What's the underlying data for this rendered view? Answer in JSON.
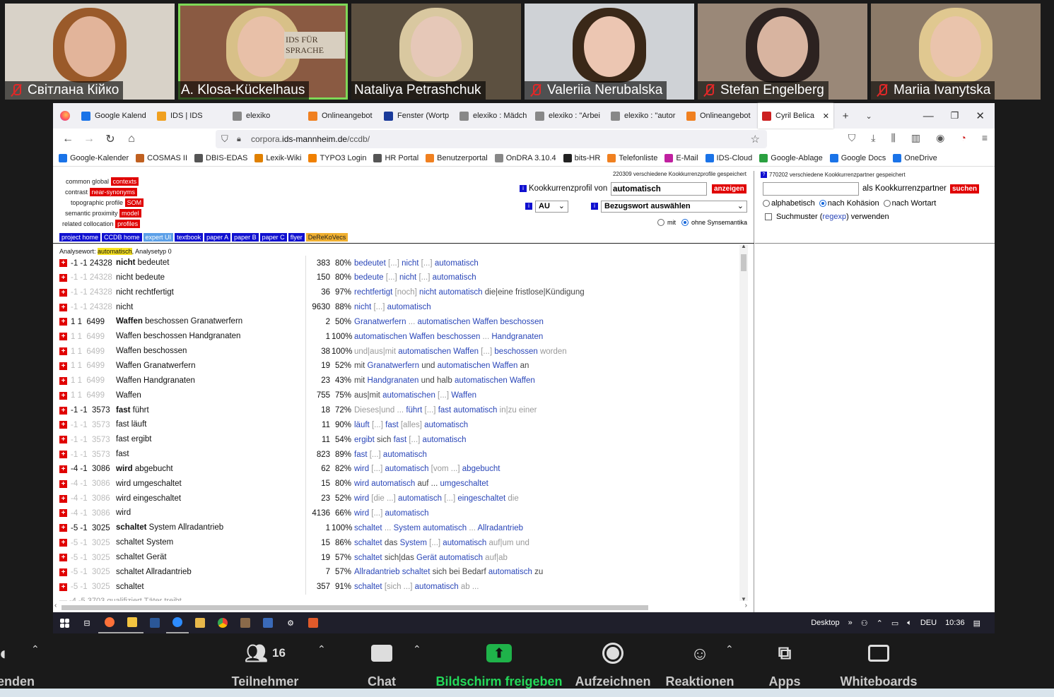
{
  "participants": [
    {
      "name": "Світлана Кійко",
      "muted": true,
      "bg": "#d8d2c8",
      "face": "#e2b49a",
      "hair": "#9a5a2a"
    },
    {
      "name": "A. Klosa-Kückelhaus",
      "muted": false,
      "active": true,
      "bg": "#8a5a42",
      "face": "#e8c0a8",
      "hair": "#d8c088",
      "banner": "IDS FÜR SPRACHE"
    },
    {
      "name": "Nataliya Petrashchuk",
      "muted": false,
      "bg": "#5c5040",
      "face": "#e6c8b8",
      "hair": "#d9c8a0"
    },
    {
      "name": "Valeriia Nerubalska",
      "muted": true,
      "bg": "#cfd2d6",
      "face": "#ecc6b2",
      "hair": "#3a2818"
    },
    {
      "name": "Stefan Engelberg",
      "muted": true,
      "bg": "#9a8878",
      "face": "#d8b4a0",
      "hair": "#2c2220"
    },
    {
      "name": "Mariia Ivanytska",
      "muted": true,
      "bg": "#8c7a68",
      "face": "#eac4ac",
      "hair": "#e0c890"
    }
  ],
  "browser": {
    "tabs": [
      {
        "label": "Google Kalend",
        "icon": "calendar-icon",
        "color": "#1a73e8"
      },
      {
        "label": "IDS | IDS",
        "icon": "ids-icon",
        "color": "#f0a020"
      },
      {
        "label": "elexiko",
        "icon": "elexiko-icon",
        "color": "#888"
      },
      {
        "label": "Onlineangebot",
        "icon": "ids-icon",
        "color": "#f08020"
      },
      {
        "label": "Fenster (Wortp",
        "icon": "doc-icon",
        "color": "#1a3a9a"
      },
      {
        "label": "elexiko : Mädch",
        "icon": "elexiko-icon",
        "color": "#888"
      },
      {
        "label": "elexiko : \"Arbei",
        "icon": "elexiko-icon",
        "color": "#888"
      },
      {
        "label": "elexiko : \"autor",
        "icon": "elexiko-icon",
        "color": "#888"
      },
      {
        "label": "Onlineangebot",
        "icon": "ids-icon",
        "color": "#f08020"
      },
      {
        "label": "Cyril Belica",
        "icon": "flag-icon",
        "color": "#cc2020",
        "active": true
      }
    ],
    "url_prefix": "corpora.",
    "url_domain": "ids-mannheim.de",
    "url_path": "/ccdb/",
    "bookmarks": [
      {
        "label": "Google-Kalender",
        "color": "#1a73e8"
      },
      {
        "label": "COSMAS II",
        "color": "#c06020"
      },
      {
        "label": "DBIS-EDAS",
        "color": "#555"
      },
      {
        "label": "Lexik-Wiki",
        "color": "#e08000"
      },
      {
        "label": "TYPO3 Login",
        "color": "#f08000"
      },
      {
        "label": "HR Portal",
        "color": "#555"
      },
      {
        "label": "Benutzerportal",
        "color": "#f08020"
      },
      {
        "label": "OnDRA 3.10.4",
        "color": "#888"
      },
      {
        "label": "bits-HR",
        "color": "#222"
      },
      {
        "label": "Telefonliste",
        "color": "#f08020"
      },
      {
        "label": "E-Mail",
        "color": "#c020a0"
      },
      {
        "label": "IDS-Cloud",
        "color": "#1a73e8"
      },
      {
        "label": "Google-Ablage",
        "color": "#2aa040"
      },
      {
        "label": "Google Docs",
        "color": "#1a73e8"
      },
      {
        "label": "OneDrive",
        "color": "#1a73e8"
      }
    ]
  },
  "ccdb": {
    "commands": [
      {
        "label": "common global",
        "tag": "contexts"
      },
      {
        "label": "contrast",
        "tag": "near-synonyms"
      },
      {
        "label": "topographic profile",
        "tag": "SOM"
      },
      {
        "label": "semantic proximity",
        "tag": "model"
      },
      {
        "label": "related collocation",
        "tag": "profiles"
      }
    ],
    "links": [
      {
        "label": "project home",
        "style": "blue"
      },
      {
        "label": "CCDB home",
        "style": "blue"
      },
      {
        "label": "expert UI",
        "style": "lblue"
      },
      {
        "label": "textbook",
        "style": "blue"
      },
      {
        "label": "paper A",
        "style": "blue"
      },
      {
        "label": "paper B",
        "style": "blue"
      },
      {
        "label": "paper C",
        "style": "blue"
      },
      {
        "label": "flyer",
        "style": "blue"
      },
      {
        "label": "DeReKoVecs",
        "style": "orange"
      }
    ],
    "profiles_count": "220309 verschiedene Kookkurrenzprofile gespeichert",
    "profile_label": "Kookkurrenzprofil von",
    "profile_value": "automatisch",
    "show_button": "anzeigen",
    "corpus": "AU",
    "reference_select": "Bezugswort auswählen",
    "radio_with": "mit",
    "radio_without": "ohne Synsemantika",
    "analysis_label": "Analysewort:",
    "analysis_word": "automatisch",
    "analysis_type": ", Analysetyp 0",
    "partners_count": "770202 verschiedene Kookkurrenzpartner gespeichert",
    "partner_label": "als Kookkurrenzpartner",
    "search_button": "suchen",
    "sort_alpha": "alphabetisch",
    "sort_cohesion": "nach Kohäsion",
    "sort_wordtype": "nach Wortart",
    "regex_pre": "Suchmuster (",
    "regex_link": "regexp",
    "regex_post": ") verwenden"
  },
  "rows": [
    {
      "idx": "-1 -1 24328",
      "g": false,
      "bold": "nicht",
      "rest": " bedeutet",
      "freq": "383",
      "pct": "80%",
      "ctx": [
        [
          "a",
          "bedeutet"
        ],
        [
          "m",
          " [...] "
        ],
        [
          "a",
          "nicht"
        ],
        [
          "m",
          " [...] "
        ],
        [
          "a",
          "automatisch"
        ]
      ]
    },
    {
      "idx": "-1 -1 24328",
      "g": true,
      "bold": "",
      "rest": "nicht bedeute",
      "freq": "150",
      "pct": "80%",
      "ctx": [
        [
          "a",
          "bedeute"
        ],
        [
          "m",
          " [...] "
        ],
        [
          "a",
          "nicht"
        ],
        [
          "m",
          " [...] "
        ],
        [
          "a",
          "automatisch"
        ]
      ]
    },
    {
      "idx": "-1 -1 24328",
      "g": true,
      "bold": "",
      "rest": "nicht rechtfertigt",
      "freq": "36",
      "pct": "97%",
      "ctx": [
        [
          "a",
          "rechtfertigt"
        ],
        [
          "m",
          " [noch] "
        ],
        [
          "a",
          "nicht automatisch"
        ],
        [
          "t",
          " die|eine fristlose|Kündigung"
        ]
      ]
    },
    {
      "idx": "-1 -1 24328",
      "g": true,
      "bold": "",
      "rest": "nicht",
      "freq": "9630",
      "pct": "88%",
      "ctx": [
        [
          "a",
          "nicht"
        ],
        [
          "m",
          " [...] "
        ],
        [
          "a",
          "automatisch"
        ]
      ]
    },
    {
      "idx": "1 1  6499",
      "g": false,
      "bold": "Waffen",
      "rest": " beschossen Granatwerfern",
      "freq": "2",
      "pct": "50%",
      "ctx": [
        [
          "a",
          "Granatwerfern"
        ],
        [
          "m",
          " ... "
        ],
        [
          "a",
          "automatischen Waffen beschossen"
        ]
      ]
    },
    {
      "idx": "1 1  6499",
      "g": true,
      "bold": "",
      "rest": "Waffen beschossen Handgranaten",
      "freq": "1",
      "pct": "100%",
      "ctx": [
        [
          "a",
          "automatischen Waffen beschossen"
        ],
        [
          "m",
          " ... "
        ],
        [
          "a",
          "Handgranaten"
        ]
      ]
    },
    {
      "idx": "1 1  6499",
      "g": true,
      "bold": "",
      "rest": "Waffen beschossen",
      "freq": "38",
      "pct": "100%",
      "ctx": [
        [
          "m",
          "und|aus|mit "
        ],
        [
          "a",
          "automatischen Waffen"
        ],
        [
          "m",
          " [...] "
        ],
        [
          "a",
          "beschossen"
        ],
        [
          "m",
          " worden"
        ]
      ]
    },
    {
      "idx": "1 1  6499",
      "g": true,
      "bold": "",
      "rest": "Waffen Granatwerfern",
      "freq": "19",
      "pct": "52%",
      "ctx": [
        [
          "t",
          "mit "
        ],
        [
          "a",
          "Granatwerfern"
        ],
        [
          "t",
          " und "
        ],
        [
          "a",
          "automatischen Waffen"
        ],
        [
          "t",
          " an"
        ]
      ]
    },
    {
      "idx": "1 1  6499",
      "g": true,
      "bold": "",
      "rest": "Waffen Handgranaten",
      "freq": "23",
      "pct": "43%",
      "ctx": [
        [
          "t",
          "mit "
        ],
        [
          "a",
          "Handgranaten"
        ],
        [
          "t",
          " und halb "
        ],
        [
          "a",
          "automatischen Waffen"
        ]
      ]
    },
    {
      "idx": "1 1  6499",
      "g": true,
      "bold": "",
      "rest": "Waffen",
      "freq": "755",
      "pct": "75%",
      "ctx": [
        [
          "t",
          "aus|mit "
        ],
        [
          "a",
          "automatischen"
        ],
        [
          "m",
          " [...] "
        ],
        [
          "a",
          "Waffen"
        ]
      ]
    },
    {
      "idx": "-1 -1  3573",
      "g": false,
      "bold": "fast",
      "rest": " führt",
      "freq": "18",
      "pct": "72%",
      "ctx": [
        [
          "m",
          "Dieses|und ... "
        ],
        [
          "a",
          "führt"
        ],
        [
          "m",
          " [...] "
        ],
        [
          "a",
          "fast automatisch"
        ],
        [
          "m",
          " in|zu einer"
        ]
      ]
    },
    {
      "idx": "-1 -1  3573",
      "g": true,
      "bold": "",
      "rest": "fast läuft",
      "freq": "11",
      "pct": "90%",
      "ctx": [
        [
          "a",
          "läuft"
        ],
        [
          "m",
          " [...] "
        ],
        [
          "a",
          "fast"
        ],
        [
          "m",
          " [alles] "
        ],
        [
          "a",
          "automatisch"
        ]
      ]
    },
    {
      "idx": "-1 -1  3573",
      "g": true,
      "bold": "",
      "rest": "fast ergibt",
      "freq": "11",
      "pct": "54%",
      "ctx": [
        [
          "a",
          "ergibt"
        ],
        [
          "t",
          " sich "
        ],
        [
          "a",
          "fast"
        ],
        [
          "m",
          " [...] "
        ],
        [
          "a",
          "automatisch"
        ]
      ]
    },
    {
      "idx": "-1 -1  3573",
      "g": true,
      "bold": "",
      "rest": "fast",
      "freq": "823",
      "pct": "89%",
      "ctx": [
        [
          "a",
          "fast"
        ],
        [
          "m",
          " [...] "
        ],
        [
          "a",
          "automatisch"
        ]
      ]
    },
    {
      "idx": "-4 -1  3086",
      "g": false,
      "bold": "wird",
      "rest": " abgebucht",
      "freq": "62",
      "pct": "82%",
      "ctx": [
        [
          "a",
          "wird"
        ],
        [
          "m",
          " [...] "
        ],
        [
          "a",
          "automatisch"
        ],
        [
          "m",
          " [vom ...] "
        ],
        [
          "a",
          "abgebucht"
        ]
      ]
    },
    {
      "idx": "-4 -1  3086",
      "g": true,
      "bold": "",
      "rest": "wird umgeschaltet",
      "freq": "15",
      "pct": "80%",
      "ctx": [
        [
          "a",
          "wird automatisch"
        ],
        [
          "t",
          " auf ... "
        ],
        [
          "a",
          "umgeschaltet"
        ]
      ]
    },
    {
      "idx": "-4 -1  3086",
      "g": true,
      "bold": "",
      "rest": "wird eingeschaltet",
      "freq": "23",
      "pct": "52%",
      "ctx": [
        [
          "a",
          "wird"
        ],
        [
          "m",
          " [die ...] "
        ],
        [
          "a",
          "automatisch"
        ],
        [
          "m",
          " [...] "
        ],
        [
          "a",
          "eingeschaltet"
        ],
        [
          "m",
          " die"
        ]
      ]
    },
    {
      "idx": "-4 -1  3086",
      "g": true,
      "bold": "",
      "rest": "wird",
      "freq": "4136",
      "pct": "66%",
      "ctx": [
        [
          "a",
          "wird"
        ],
        [
          "m",
          " [...] "
        ],
        [
          "a",
          "automatisch"
        ]
      ]
    },
    {
      "idx": "-5 -1  3025",
      "g": false,
      "bold": "schaltet",
      "rest": " System Allradantrieb",
      "freq": "1",
      "pct": "100%",
      "ctx": [
        [
          "a",
          "schaltet"
        ],
        [
          "m",
          " ... "
        ],
        [
          "a",
          "System automatisch"
        ],
        [
          "m",
          " ... "
        ],
        [
          "a",
          "Allradantrieb"
        ]
      ]
    },
    {
      "idx": "-5 -1  3025",
      "g": true,
      "bold": "",
      "rest": "schaltet System",
      "freq": "15",
      "pct": "86%",
      "ctx": [
        [
          "a",
          "schaltet"
        ],
        [
          "t",
          " das "
        ],
        [
          "a",
          "System"
        ],
        [
          "m",
          " [...] "
        ],
        [
          "a",
          "automatisch"
        ],
        [
          "m",
          " auf|um und"
        ]
      ]
    },
    {
      "idx": "-5 -1  3025",
      "g": true,
      "bold": "",
      "rest": "schaltet Gerät",
      "freq": "19",
      "pct": "57%",
      "ctx": [
        [
          "a",
          "schaltet"
        ],
        [
          "t",
          " sich|das "
        ],
        [
          "a",
          "Gerät automatisch"
        ],
        [
          "m",
          " auf|ab"
        ]
      ]
    },
    {
      "idx": "-5 -1  3025",
      "g": true,
      "bold": "",
      "rest": "schaltet Allradantrieb",
      "freq": "7",
      "pct": "57%",
      "ctx": [
        [
          "a",
          "Allradantrieb schaltet"
        ],
        [
          "t",
          " sich bei Bedarf "
        ],
        [
          "a",
          "automatisch"
        ],
        [
          "t",
          " zu"
        ]
      ]
    },
    {
      "idx": "-5 -1  3025",
      "g": true,
      "bold": "",
      "rest": "schaltet",
      "freq": "357",
      "pct": "91%",
      "ctx": [
        [
          "a",
          "schaltet"
        ],
        [
          "m",
          " [sich ...] "
        ],
        [
          "a",
          "automatisch"
        ],
        [
          "m",
          " ab ..."
        ]
      ]
    }
  ],
  "taskbar": {
    "desktop": "Desktop",
    "lang": "DEU",
    "time": "10:36"
  },
  "zoom": {
    "end": "enden",
    "participants": "Teilnehmer",
    "participants_count": "16",
    "chat": "Chat",
    "share": "Bildschirm freigeben",
    "record": "Aufzeichnen",
    "reactions": "Reaktionen",
    "apps": "Apps",
    "whiteboards": "Whiteboards",
    "share_color": "#23d959",
    "share_icon_bg": "#1fb34a"
  }
}
